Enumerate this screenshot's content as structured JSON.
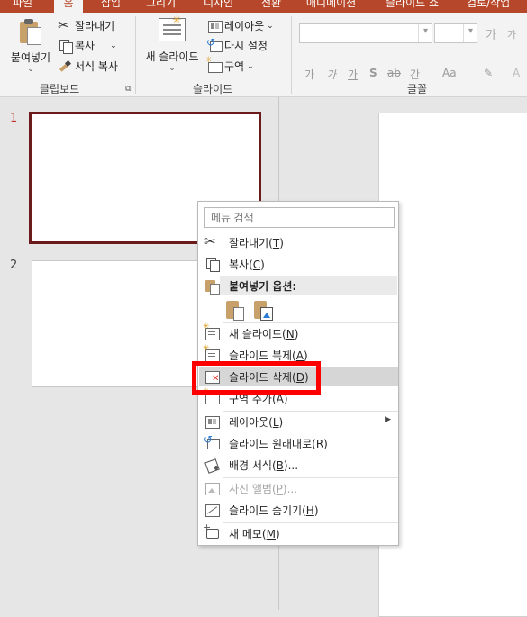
{
  "ribbon_tabs": [
    "파일",
    "홈",
    "삽입",
    "그리기",
    "디자인",
    "전환",
    "애니메이션",
    "슬라이드 쇼",
    "검토/작업"
  ],
  "ribbon": {
    "clipboard": {
      "paste_label": "붙여넣기",
      "cut_label": "잘라내기",
      "copy_label": "복사",
      "format_painter_label": "서식 복사",
      "group_label": "클립보드"
    },
    "slides": {
      "new_slide_label": "새 슬라이드",
      "layout_label": "레이아웃",
      "reset_label": "다시 설정",
      "section_label": "구역",
      "group_label": "슬라이드"
    },
    "font": {
      "group_label": "글꼴",
      "format_buttons": [
        "가",
        "가",
        "가",
        "S",
        "ab",
        "간",
        "Aa"
      ]
    }
  },
  "thumbnails": [
    {
      "number": "1",
      "selected": true
    },
    {
      "number": "2",
      "selected": false
    }
  ],
  "context_menu": {
    "search_placeholder": "메뉴 검색",
    "items": [
      {
        "label": "잘라내기(",
        "key": "T",
        "suffix": ")",
        "icon": "scissors-icon"
      },
      {
        "label": "복사(",
        "key": "C",
        "suffix": ")",
        "icon": "copy-icon"
      },
      {
        "label": "붙여넣기 옵션:",
        "icon": "clipboard-icon"
      },
      {
        "label": "새 슬라이드(",
        "key": "N",
        "suffix": ")",
        "icon": "new-slide-icon"
      },
      {
        "label": "슬라이드 복제(",
        "key": "A",
        "suffix": ")",
        "icon": "duplicate-slide-icon"
      },
      {
        "label": "슬라이드 삭제(",
        "key": "D",
        "suffix": ")",
        "icon": "delete-slide-icon",
        "hovered": true
      },
      {
        "label": "구역 추가(",
        "key": "A",
        "suffix": ")",
        "icon": "add-section-icon"
      },
      {
        "label": "레이아웃(",
        "key": "L",
        "suffix": ")",
        "icon": "layout-icon",
        "submenu": true
      },
      {
        "label": "슬라이드 원래대로(",
        "key": "R",
        "suffix": ")",
        "icon": "reset-slide-icon"
      },
      {
        "label": "배경 서식(",
        "key": "B",
        "suffix": ")...",
        "icon": "format-background-icon"
      },
      {
        "label": "사진 앨범(",
        "key": "P",
        "suffix": ")...",
        "icon": "photo-album-icon",
        "disabled": true
      },
      {
        "label": "슬라이드 숨기기(",
        "key": "H",
        "suffix": ")",
        "icon": "hide-slide-icon"
      },
      {
        "label": "새 메모(",
        "key": "M",
        "suffix": ")",
        "icon": "new-comment-icon"
      }
    ]
  },
  "colors": {
    "accent": "#b7472a",
    "highlight_box": "#ff0000",
    "selected_thumb_border": "#6b1b1b"
  }
}
